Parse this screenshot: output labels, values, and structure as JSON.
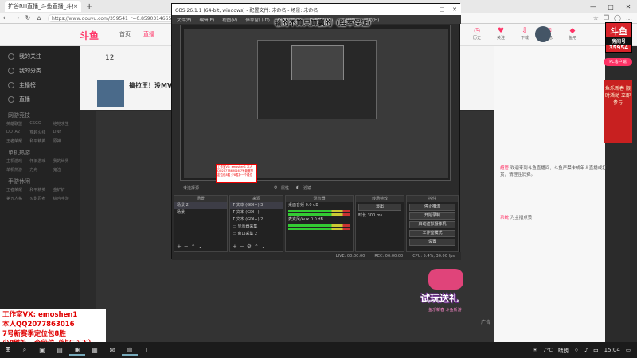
{
  "browser": {
    "tab_title": "扩谷RH直播_斗鱼直播_斗鱼...",
    "tab_close": "×",
    "new_tab": "+",
    "win_min": "—",
    "win_max": "□",
    "win_close": "✕",
    "url": "https://www.douyu.com/359541_r=0.859031466534380",
    "nav_back": "←",
    "nav_forward": "→",
    "nav_refresh": "↻",
    "nav_home": "⌂"
  },
  "site": {
    "logo": "斗鱼",
    "nav": [
      "首页",
      "直播"
    ],
    "header_icons": [
      {
        "icon": "history-icon",
        "label": "历史"
      },
      {
        "icon": "follow-icon",
        "label": "关注"
      },
      {
        "icon": "download-icon",
        "label": "下载"
      },
      {
        "icon": "message-icon",
        "label": "消息"
      },
      {
        "icon": "fish-icon",
        "label": "鱼吧"
      }
    ],
    "badge": {
      "line1": "斗鱼",
      "line2": "房间号",
      "line3": "35954"
    },
    "pc_button": "PC客户端"
  },
  "sidebar": {
    "items": [
      "我的关注",
      "我的分类",
      "主播榜",
      "直播"
    ],
    "section1": "网游竞技",
    "section1_items": [
      "英雄联盟",
      "CSGO",
      "绝地求生",
      "DOTA2",
      "穿越火线",
      "DNF",
      "王者荣耀",
      "和平精英",
      "原神"
    ],
    "section2": "单机热游",
    "section2_items": [
      "主机游戏",
      "怀旧游戏",
      "我的世界",
      "单机热游",
      "方舟",
      "鬼泣"
    ],
    "section3": "手游休闲",
    "section3_items": [
      "王者荣耀",
      "和平精英",
      "金铲铲",
      "第五人格",
      "火影忍者",
      "综合手游"
    ]
  },
  "stream": {
    "count": "12",
    "title": "搞拉王！没MVP"
  },
  "chat": [
    {
      "user": "超管",
      "text": "欢迎来到斗鱼直播间，斗鱼严禁未成年人直播或打赏，请理性消费。"
    },
    {
      "user": "系统",
      "text": "为主播点赞"
    }
  ],
  "ad": {
    "text": "鱼乐新春 限时活动 立即参与"
  },
  "obs": {
    "title": "OBS 26.1.1 (64-bit, windows) - 配置文件: 未命名 - 场景: 未命名",
    "menu": [
      "文件(F)",
      "编辑(E)",
      "视图(V)",
      "停靠窗口(D)",
      "配置文件(P)",
      "场景集合(S)",
      "工具(T)",
      "帮助(H)"
    ],
    "nested_box": "工作室VX: emoshen1 本人QQ2077863016 7号新赛季定位包8胜 少8胜补一个段位",
    "scene_label": "未选择源",
    "props": "属性",
    "filters": "滤镜",
    "docks": {
      "scenes": {
        "title": "场景",
        "items": [
          "场景 2",
          "场景"
        ]
      },
      "sources": {
        "title": "来源",
        "items": [
          "文本 (GDI+) 3",
          "文本 (GDI+)",
          "文本 (GDI+) 2",
          "显示器采集",
          "窗口采集 2"
        ]
      },
      "mixer": {
        "title": "混音器",
        "channels": [
          {
            "name": "桌面音频",
            "db": "0.0 dB"
          },
          {
            "name": "麦克风/Aux",
            "db": "0.0 dB"
          }
        ]
      },
      "transitions": {
        "title": "转场特效",
        "type": "淡出",
        "duration_label": "时长",
        "duration": "300 ms"
      },
      "controls": {
        "title": "控件",
        "buttons": [
          "停止推流",
          "开始录制",
          "启动虚拟摄像机",
          "工作室模式",
          "设置",
          "退出"
        ]
      }
    },
    "status": {
      "live": "LIVE: 00:00:00",
      "rec": "REC: 00:00:00",
      "cpu": "CPU: 5.4%, 30.00 fps"
    }
  },
  "overlay": {
    "text": "输的不算只算赢的（胜率保证）"
  },
  "promo": {
    "text": "试玩送礼",
    "sub": "鱼乐新春 斗鱼新游"
  },
  "ad_label": "广告",
  "studio": {
    "lines": [
      "工作室VX: emoshen1",
      "本人QQ2077863016",
      "7号新赛季定位包8胜",
      "少8胜补一个段位（钻石以下）"
    ]
  },
  "taskbar": {
    "start": "⊞",
    "icons": [
      "search-icon",
      "taskview-icon",
      "explorer-icon",
      "edge-icon",
      "store-icon",
      "mail-icon",
      "obs-icon",
      "app-icon"
    ],
    "temp": "7°C",
    "weather": "晴朗",
    "lang": "中",
    "time": "15:04"
  }
}
